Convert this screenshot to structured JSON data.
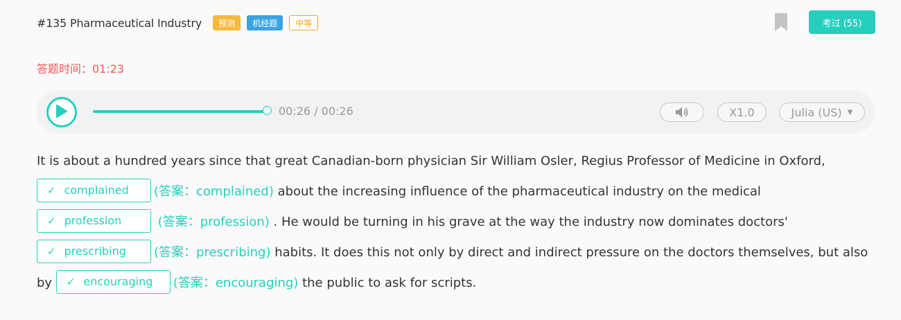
{
  "header": {
    "title": "#135 Pharmaceutical Industry",
    "tags": [
      "预测",
      "机经题",
      "中等"
    ],
    "passed_button": "考过 (55)"
  },
  "timer": {
    "label": "答题时间：01:23"
  },
  "player": {
    "time": "00:26 / 00:26",
    "progress": 1.0,
    "speed": "X1.0",
    "voice": "Julia (US)"
  },
  "passage": {
    "p1": "It is about a hundred years since that great Canadian-born physician Sir William Osler, Regius Professor of Medicine in Oxford,",
    "p2": " about the increasing influence of the pharmaceutical industry on the medical ",
    "p3": " . He would be turning in his grave at the way the industry now dominates doctors' ",
    "p4": " habits. It does this not only by direct and indirect pressure on the doctors themselves, but also by ",
    "p5": " the public to ask for scripts.",
    "blanks": [
      {
        "value": "complained",
        "answer": "(答案：complained)"
      },
      {
        "value": "profession",
        "answer": "(答案：profession)"
      },
      {
        "value": "prescribing",
        "answer": "(答案：prescribing)"
      },
      {
        "value": "encouraging",
        "answer": "(答案：encouraging)"
      }
    ]
  },
  "colors": {
    "accent": "#26cfbd",
    "timer": "#ee5a57",
    "tag_predict": "#f5b93d",
    "tag_machine": "#3aa3e3",
    "tag_level": "#f0a22c"
  },
  "icons": {
    "play": "play-icon",
    "bookmark": "bookmark-icon",
    "volume": "volume-icon",
    "check": "check-icon",
    "caret": "caret-down-icon"
  }
}
